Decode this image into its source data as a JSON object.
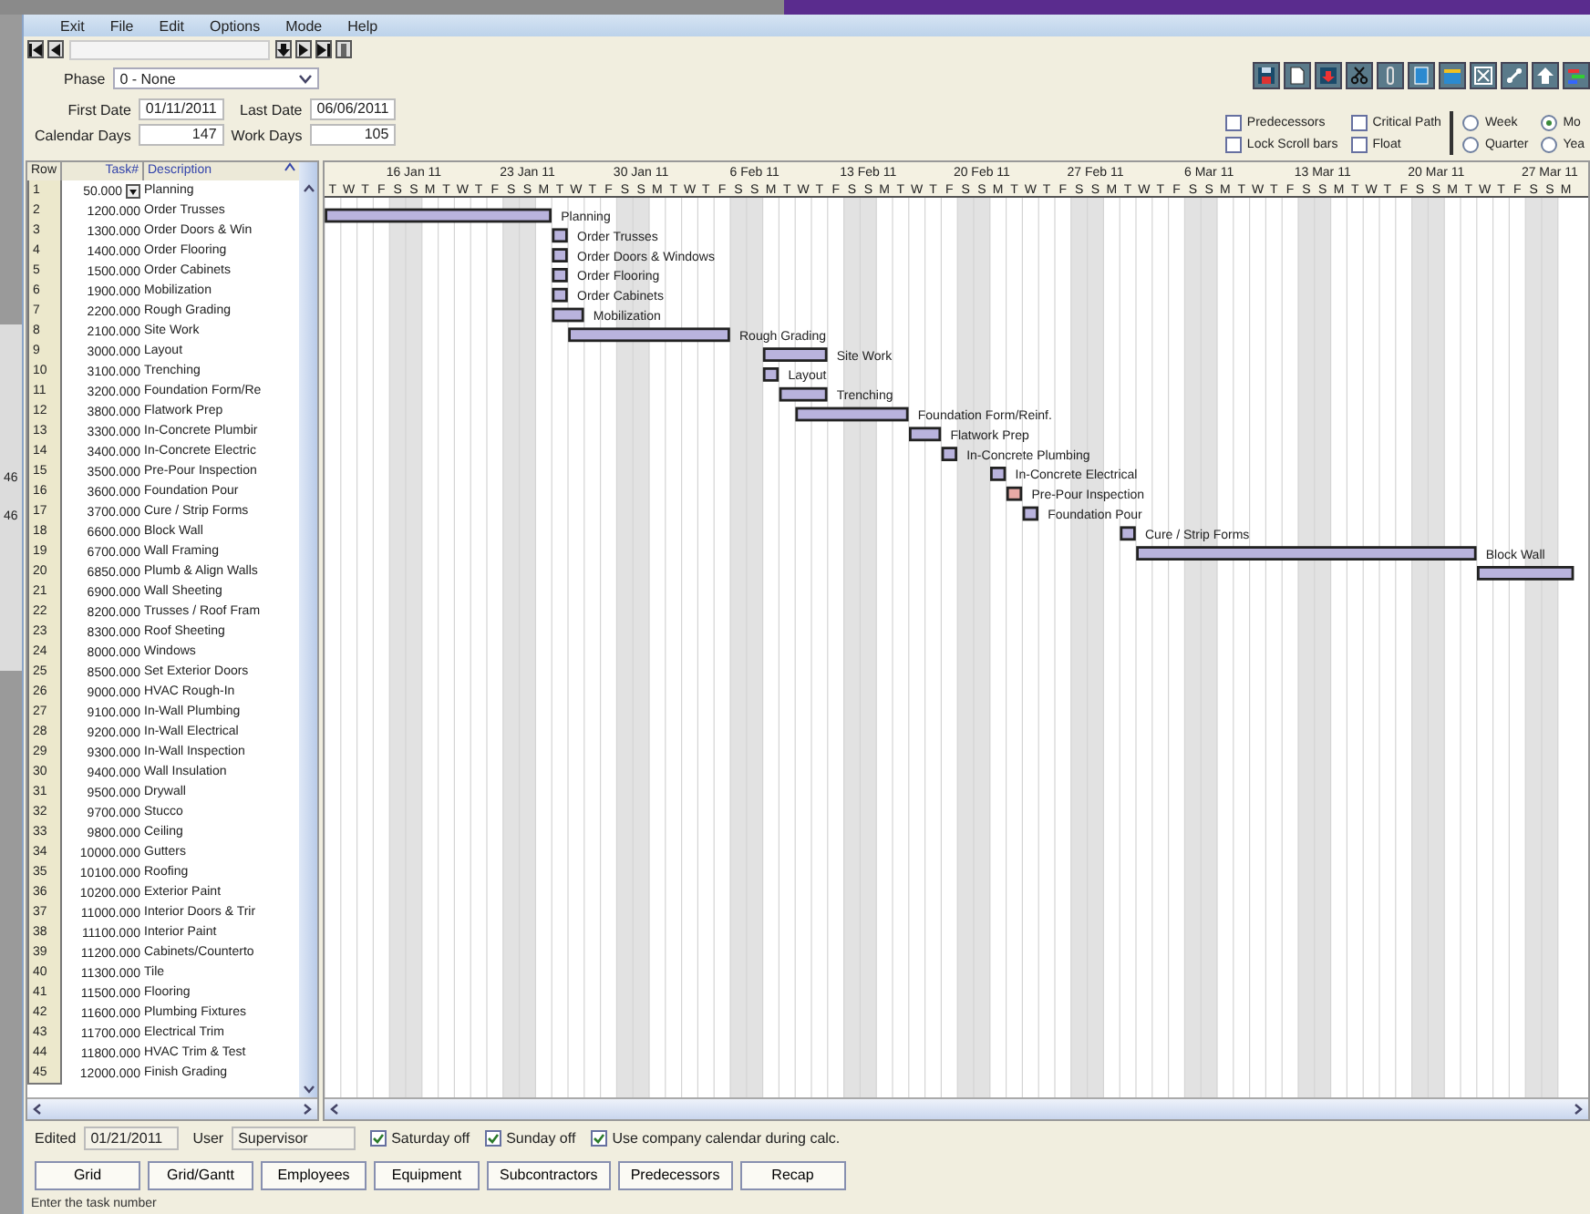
{
  "background": {
    "texts": [
      "46",
      "46"
    ]
  },
  "menu": [
    "Exit",
    "File",
    "Edit",
    "Options",
    "Mode",
    "Help"
  ],
  "phase": {
    "label": "Phase",
    "value": "0 - None"
  },
  "dates": [
    {
      "label": "First Date",
      "value": "01/11/2011"
    },
    {
      "label": "Last Date",
      "value": "06/06/2011"
    },
    {
      "label": "Calendar Days",
      "value": "147"
    },
    {
      "label": "Work Days",
      "value": "105"
    }
  ],
  "options": [
    {
      "label": "Predecessors",
      "checked": false
    },
    {
      "label": "Lock Scroll bars",
      "checked": false
    },
    {
      "label": "Critical Path",
      "checked": false
    },
    {
      "label": "Float",
      "checked": false
    }
  ],
  "view": [
    {
      "label": "Week",
      "selected": false
    },
    {
      "label": "Quarter",
      "selected": false
    },
    {
      "label": "Mo",
      "selected": true
    },
    {
      "label": "Yea",
      "selected": false
    }
  ],
  "table": {
    "columns": [
      "Row",
      "Task#",
      "Description"
    ],
    "rows": [
      [
        "1",
        "50.000",
        "Planning"
      ],
      [
        "2",
        "1200.000",
        "Order  Trusses"
      ],
      [
        "3",
        "1300.000",
        "Order  Doors & Win"
      ],
      [
        "4",
        "1400.000",
        "Order  Flooring"
      ],
      [
        "5",
        "1500.000",
        "Order  Cabinets"
      ],
      [
        "6",
        "1900.000",
        "Mobilization"
      ],
      [
        "7",
        "2200.000",
        "Rough  Grading"
      ],
      [
        "8",
        "2100.000",
        "Site Work"
      ],
      [
        "9",
        "3000.000",
        "Layout"
      ],
      [
        "10",
        "3100.000",
        "Trenching"
      ],
      [
        "11",
        "3200.000",
        "Foundation Form/Re"
      ],
      [
        "12",
        "3800.000",
        "Flatwork Prep"
      ],
      [
        "13",
        "3300.000",
        "In-Concrete Plumbir"
      ],
      [
        "14",
        "3400.000",
        "In-Concrete Electric"
      ],
      [
        "15",
        "3500.000",
        "Pre-Pour Inspection"
      ],
      [
        "16",
        "3600.000",
        "Foundation Pour"
      ],
      [
        "17",
        "3700.000",
        "Cure / Strip Forms"
      ],
      [
        "18",
        "6600.000",
        "Block Wall"
      ],
      [
        "19",
        "6700.000",
        "Wall  Framing"
      ],
      [
        "20",
        "6850.000",
        "Plumb & Align Walls"
      ],
      [
        "21",
        "6900.000",
        "Wall Sheeting"
      ],
      [
        "22",
        "8200.000",
        "Trusses / Roof Fram"
      ],
      [
        "23",
        "8300.000",
        "Roof Sheeting"
      ],
      [
        "24",
        "8000.000",
        "Windows"
      ],
      [
        "25",
        "8500.000",
        "Set Exterior Doors"
      ],
      [
        "26",
        "9000.000",
        "HVAC Rough-In"
      ],
      [
        "27",
        "9100.000",
        "In-Wall Plumbing"
      ],
      [
        "28",
        "9200.000",
        "In-Wall Electrical"
      ],
      [
        "29",
        "9300.000",
        "In-Wall Inspection"
      ],
      [
        "30",
        "9400.000",
        "Wall Insulation"
      ],
      [
        "31",
        "9500.000",
        "Drywall"
      ],
      [
        "32",
        "9700.000",
        "Stucco"
      ],
      [
        "33",
        "9800.000",
        "Ceiling"
      ],
      [
        "34",
        "10000.000",
        "Gutters"
      ],
      [
        "35",
        "10100.000",
        "Roofing"
      ],
      [
        "36",
        "10200.000",
        "Exterior Paint"
      ],
      [
        "37",
        "11000.000",
        "Interior Doors & Trir"
      ],
      [
        "38",
        "11100.000",
        "Interior  Paint"
      ],
      [
        "39",
        "11200.000",
        "Cabinets/Counterto"
      ],
      [
        "40",
        "11300.000",
        "Tile"
      ],
      [
        "41",
        "11500.000",
        "Flooring"
      ],
      [
        "42",
        "11600.000",
        "Plumbing Fixtures"
      ],
      [
        "43",
        "11700.000",
        "Electrical Trim"
      ],
      [
        "44",
        "11800.000",
        "HVAC Trim & Test"
      ],
      [
        "45",
        "12000.000",
        "Finish Grading"
      ]
    ]
  },
  "gantt": {
    "days": [
      {
        "letter": "T",
        "shaded": false
      },
      {
        "letter": "W",
        "shaded": false
      },
      {
        "letter": "T",
        "shaded": false
      },
      {
        "letter": "F",
        "shaded": false
      },
      {
        "letter": "S",
        "shaded": true
      },
      {
        "letter": "S",
        "shaded": true
      },
      {
        "letter": "M",
        "shaded": false
      },
      {
        "letter": "T",
        "shaded": false
      },
      {
        "letter": "W",
        "shaded": false
      },
      {
        "letter": "T",
        "shaded": false
      },
      {
        "letter": "F",
        "shaded": false
      },
      {
        "letter": "S",
        "shaded": true
      },
      {
        "letter": "S",
        "shaded": true
      },
      {
        "letter": "M",
        "shaded": false
      },
      {
        "letter": "T",
        "shaded": false
      },
      {
        "letter": "W",
        "shaded": false
      },
      {
        "letter": "T",
        "shaded": false
      },
      {
        "letter": "F",
        "shaded": false
      },
      {
        "letter": "S",
        "shaded": true
      },
      {
        "letter": "S",
        "shaded": true
      },
      {
        "letter": "M",
        "shaded": false
      },
      {
        "letter": "T",
        "shaded": false
      },
      {
        "letter": "W",
        "shaded": false
      },
      {
        "letter": "T",
        "shaded": false
      },
      {
        "letter": "F",
        "shaded": false
      },
      {
        "letter": "S",
        "shaded": true
      },
      {
        "letter": "S",
        "shaded": true
      },
      {
        "letter": "M",
        "shaded": false
      },
      {
        "letter": "T",
        "shaded": false
      },
      {
        "letter": "W",
        "shaded": false
      },
      {
        "letter": "T",
        "shaded": false
      },
      {
        "letter": "F",
        "shaded": false
      },
      {
        "letter": "S",
        "shaded": true
      },
      {
        "letter": "S",
        "shaded": true
      },
      {
        "letter": "M",
        "shaded": false
      },
      {
        "letter": "T",
        "shaded": false
      },
      {
        "letter": "W",
        "shaded": false
      },
      {
        "letter": "T",
        "shaded": false
      },
      {
        "letter": "F",
        "shaded": false
      },
      {
        "letter": "S",
        "shaded": true
      },
      {
        "letter": "S",
        "shaded": true
      },
      {
        "letter": "M",
        "shaded": false
      },
      {
        "letter": "T",
        "shaded": false
      },
      {
        "letter": "W",
        "shaded": false
      },
      {
        "letter": "T",
        "shaded": false
      },
      {
        "letter": "F",
        "shaded": false
      },
      {
        "letter": "S",
        "shaded": true
      },
      {
        "letter": "S",
        "shaded": true
      },
      {
        "letter": "M",
        "shaded": false
      },
      {
        "letter": "T",
        "shaded": false
      },
      {
        "letter": "W",
        "shaded": false
      },
      {
        "letter": "T",
        "shaded": false
      },
      {
        "letter": "F",
        "shaded": false
      },
      {
        "letter": "S",
        "shaded": true
      },
      {
        "letter": "S",
        "shaded": true
      },
      {
        "letter": "M",
        "shaded": false
      },
      {
        "letter": "T",
        "shaded": false
      },
      {
        "letter": "W",
        "shaded": false
      },
      {
        "letter": "T",
        "shaded": false
      },
      {
        "letter": "F",
        "shaded": false
      },
      {
        "letter": "S",
        "shaded": true
      },
      {
        "letter": "S",
        "shaded": true
      },
      {
        "letter": "M",
        "shaded": false
      },
      {
        "letter": "T",
        "shaded": false
      },
      {
        "letter": "W",
        "shaded": false
      },
      {
        "letter": "T",
        "shaded": false
      },
      {
        "letter": "F",
        "shaded": false
      },
      {
        "letter": "S",
        "shaded": true
      },
      {
        "letter": "S",
        "shaded": true
      },
      {
        "letter": "M",
        "shaded": false
      },
      {
        "letter": "T",
        "shaded": false
      },
      {
        "letter": "W",
        "shaded": false
      },
      {
        "letter": "T",
        "shaded": false
      },
      {
        "letter": "F",
        "shaded": false
      },
      {
        "letter": "S",
        "shaded": true
      },
      {
        "letter": "S",
        "shaded": true
      },
      {
        "letter": "M",
        "shaded": false
      }
    ],
    "week_labels": [
      "16 Jan 11",
      "23 Jan 11",
      "30 Jan 11",
      "6 Feb 11",
      "13 Feb 11",
      "20 Feb 11",
      "27 Feb 11",
      "6 Mar 11",
      "13 Mar 11",
      "20 Mar 11",
      "27 Mar 11"
    ],
    "tasks": [
      {
        "label": "Planning",
        "kind": "task"
      },
      {
        "label": "Order  Trusses",
        "kind": "task"
      },
      {
        "label": "Order  Doors & Windows",
        "kind": "task"
      },
      {
        "label": "Order  Flooring",
        "kind": "task"
      },
      {
        "label": "Order  Cabinets",
        "kind": "task"
      },
      {
        "label": "Mobilization",
        "kind": "task"
      },
      {
        "label": "Rough  Grading",
        "kind": "task"
      },
      {
        "label": "Site Work",
        "kind": "task"
      },
      {
        "label": "Layout",
        "kind": "task"
      },
      {
        "label": "Trenching",
        "kind": "task"
      },
      {
        "label": "Foundation Form/Reinf.",
        "kind": "task"
      },
      {
        "label": "Flatwork Prep",
        "kind": "task"
      },
      {
        "label": "In-Concrete Plumbing",
        "kind": "task"
      },
      {
        "label": "In-Concrete Electrical",
        "kind": "task"
      },
      {
        "label": "Pre-Pour Inspection",
        "kind": "inspection"
      },
      {
        "label": "Foundation Pour",
        "kind": "task"
      },
      {
        "label": "Cure / Strip Forms",
        "kind": "task"
      },
      {
        "label": "Block Wall",
        "kind": "task"
      },
      {
        "kind": "task"
      }
    ]
  },
  "footer": {
    "edited": {
      "label": "Edited",
      "value": "01/21/2011"
    },
    "user": {
      "label": "User",
      "value": "Supervisor"
    },
    "checks": [
      {
        "label": "Saturday off",
        "checked": true
      },
      {
        "label": "Sunday off",
        "checked": true
      },
      {
        "label": "Use company calendar during calc.",
        "checked": true
      }
    ]
  },
  "buttons": [
    "Grid",
    "Grid/Gantt",
    "Employees",
    "Equipment",
    "Subcontractors",
    "Predecessors",
    "Recap"
  ],
  "status_bar": "Enter the task number"
}
